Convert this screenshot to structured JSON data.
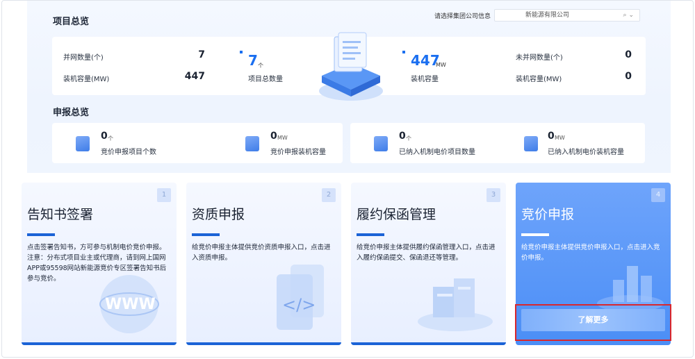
{
  "project_overview": {
    "title": "项目总览",
    "company_label": "请选择集团公司信息",
    "company_selected": "新能源有限公司",
    "grid_count_label": "并网数量(个)",
    "grid_count_value": "7",
    "grid_capacity_label": "装机容量(MW)",
    "grid_capacity_value": "447",
    "total_projects_value": "7",
    "total_projects_unit": "个",
    "total_projects_label": "项目总数量",
    "total_capacity_value": "447",
    "total_capacity_unit": "MW",
    "total_capacity_label": "装机容量",
    "ungrid_count_label": "未并网数量(个)",
    "ungrid_count_value": "0",
    "ungrid_capacity_label": "装机容量(MW)",
    "ungrid_capacity_value": "0"
  },
  "report_overview": {
    "title": "申报总览",
    "items": [
      {
        "value": "0",
        "unit": "个",
        "label": "竞价申报项目个数",
        "icon": "building-icon"
      },
      {
        "value": "0",
        "unit": "MW",
        "label": "竞价申报装机容量",
        "icon": "document-check-icon"
      },
      {
        "value": "0",
        "unit": "个",
        "label": "已纳入机制电价项目数量",
        "icon": "calculator-icon"
      },
      {
        "value": "0",
        "unit": "MW",
        "label": "已纳入机制电价装机容量",
        "icon": "document-edit-icon"
      }
    ]
  },
  "cards": [
    {
      "num": "1",
      "title": "告知书签署",
      "desc": "点击签署告知书，方可参与机制电价竞价申报。注意：分布式项目业主或代理商，请到网上国网APP或95598网站新能源竞价专区签署告知书后参与竞价。",
      "deco": "www-globe-icon"
    },
    {
      "num": "2",
      "title": "资质申报",
      "desc": "给竞价申报主体提供竞价资质申报入口，点击进入资质申报。",
      "deco": "code-document-icon"
    },
    {
      "num": "3",
      "title": "履约保函管理",
      "desc": "给竞价申报主体提供履约保函管理入口，点击进入履约保函提交、保函退还等管理。",
      "deco": "server-stack-icon"
    },
    {
      "num": "4",
      "title": "竞价申报",
      "desc": "给竞价申报主体提供竞价申报入口，点击进入竞价申报。",
      "deco": "chart-bars-icon",
      "button": "了解更多"
    }
  ],
  "colors": {
    "accent": "#1b6ff0",
    "card_active": "#5b97f8",
    "highlight": "#d9262c"
  }
}
